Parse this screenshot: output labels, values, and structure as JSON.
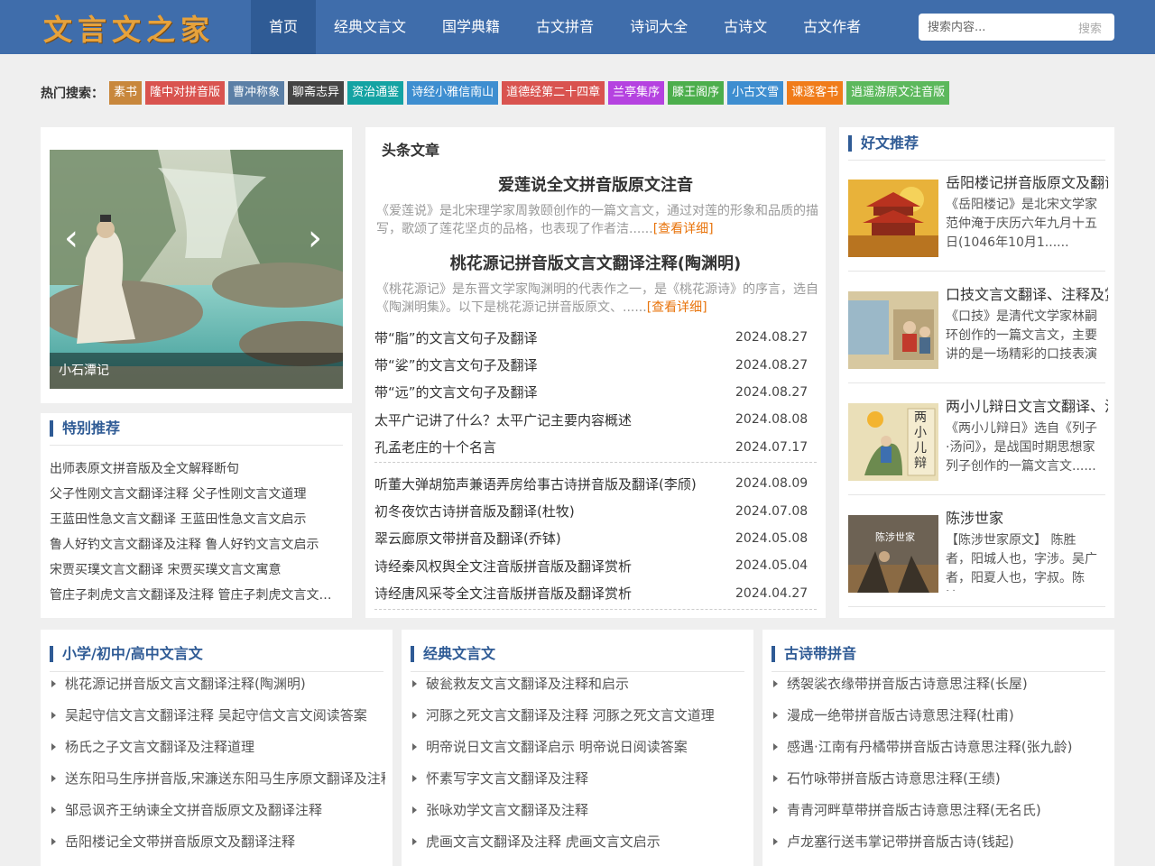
{
  "header": {
    "logo": "文言文之家",
    "nav": [
      "首页",
      "经典文言文",
      "国学典籍",
      "古文拼音",
      "诗词大全",
      "古诗文",
      "古文作者"
    ],
    "search_placeholder": "搜索内容...",
    "search_button": "搜索"
  },
  "hot": {
    "label": "热门搜索：",
    "tags": [
      {
        "text": "素书",
        "color": "#c8873c"
      },
      {
        "text": "隆中对拼音版",
        "color": "#d9534f"
      },
      {
        "text": "曹冲称象",
        "color": "#5b7fa6"
      },
      {
        "text": "聊斋志异",
        "color": "#444444"
      },
      {
        "text": "资治通鉴",
        "color": "#14a3a3"
      },
      {
        "text": "诗经小雅信南山",
        "color": "#3e8ed0"
      },
      {
        "text": "道德经第二十四章",
        "color": "#d9534f"
      },
      {
        "text": "兰亭集序",
        "color": "#b542e0"
      },
      {
        "text": "滕王阁序",
        "color": "#4cae4c"
      },
      {
        "text": "小古文雪",
        "color": "#3e8ed0"
      },
      {
        "text": "谏逐客书",
        "color": "#f07c1a"
      },
      {
        "text": "逍遥游原文注音版",
        "color": "#5cb85c"
      }
    ]
  },
  "slider": {
    "caption": "小石潭记"
  },
  "special": {
    "title": "特别推荐",
    "items": [
      "出师表原文拼音版及全文解释断句",
      "父子性刚文言文翻译注释 父子性刚文言文道理",
      "王蓝田性急文言文翻译 王蓝田性急文言文启示",
      "鲁人好钓文言文翻译及注释 鲁人好钓文言文启示",
      "宋贾买璞文言文翻译 宋贾买璞文言文寓意",
      "管庄子刺虎文言文翻译及注释 管庄子刺虎文言文启示"
    ]
  },
  "headline": {
    "heading": "头条文章",
    "featured": [
      {
        "title": "爱莲说全文拼音版原文注音",
        "desc": "《爱莲说》是北宋理学家周敦颐创作的一篇文言文，通过对莲的形象和品质的描写，歌颂了莲花坚贞的品格，也表现了作者洁......",
        "more": "[查看详细]"
      },
      {
        "title": "桃花源记拼音版文言文翻译注释(陶渊明)",
        "desc": "《桃花源记》是东晋文学家陶渊明的代表作之一，是《桃花源诗》的序言，选自《陶渊明集》。以下是桃花源记拼音版原文、......",
        "more": "[查看详细]"
      }
    ],
    "list1": [
      {
        "title": "带“脂”的文言文句子及翻译",
        "date": "2024.08.27"
      },
      {
        "title": "带“娑”的文言文句子及翻译",
        "date": "2024.08.27"
      },
      {
        "title": "带“远”的文言文句子及翻译",
        "date": "2024.08.27"
      },
      {
        "title": "太平广记讲了什么？太平广记主要内容概述",
        "date": "2024.08.08"
      },
      {
        "title": "孔孟老庄的十个名言",
        "date": "2024.07.17"
      }
    ],
    "list2": [
      {
        "title": "听董大弹胡笳声兼语弄房给事古诗拼音版及翻译(李颀)",
        "date": "2024.08.09"
      },
      {
        "title": "初冬夜饮古诗拼音版及翻译(杜牧)",
        "date": "2024.07.08"
      },
      {
        "title": "翠云廊原文带拼音及翻译(乔钵)",
        "date": "2024.05.08"
      },
      {
        "title": "诗经秦风权舆全文注音版拼音版及翻译赏析",
        "date": "2024.05.04"
      },
      {
        "title": "诗经唐风采苓全文注音版拼音版及翻译赏析",
        "date": "2024.04.27"
      }
    ]
  },
  "recommend": {
    "title": "好文推荐",
    "items": [
      {
        "title": "岳阳楼记拼音版原文及翻译",
        "desc": "《岳阳楼记》是北宋文学家范仲淹于庆历六年九月十五日(1046年10月1......"
      },
      {
        "title": "口技文言文翻译、注释及赏析",
        "desc": "《口技》是清代文学家林嗣环创作的一篇文言文，主要讲的是一场精彩的口技表演"
      },
      {
        "title": "两小儿辩日文言文翻译、注释",
        "desc": "《两小儿辩日》选自《列子·汤问》，是战国时期思想家列子创作的一篇文言文......"
      },
      {
        "title": "陈涉世家",
        "desc": "【陈涉世家原文】 陈胜者，阳城人也，字涉。吴广者，阳夏人也，字叔。陈涉......"
      }
    ],
    "thumb_labels": [
      "两小儿辩",
      "陈涉世家"
    ]
  },
  "bottom": [
    {
      "title": "小学/初中/高中文言文",
      "items": [
        "桃花源记拼音版文言文翻译注释(陶渊明)",
        "吴起守信文言文翻译注释 吴起守信文言文阅读答案",
        "杨氏之子文言文翻译及注释道理",
        "送东阳马生序拼音版,宋濂送东阳马生序原文翻译及注释",
        "邹忌讽齐王纳谏全文拼音版原文及翻译注释",
        "岳阳楼记全文带拼音版原文及翻译注释"
      ]
    },
    {
      "title": "经典文言文",
      "items": [
        "破瓮救友文言文翻译及注释和启示",
        "河豚之死文言文翻译及注释 河豚之死文言文道理",
        "明帝说日文言文翻译启示 明帝说日阅读答案",
        "怀素写字文言文翻译及注释",
        "张咏劝学文言文翻译及注释",
        "虎画文言文翻译及注释 虎画文言文启示"
      ]
    },
    {
      "title": "古诗带拼音",
      "items": [
        "绣袈裟衣缘带拼音版古诗意思注释(长屋)",
        "漫成一绝带拼音版古诗意思注释(杜甫)",
        "感遇·江南有丹橘带拼音版古诗意思注释(张九龄)",
        "石竹咏带拼音版古诗意思注释(王绩)",
        "青青河畔草带拼音版古诗意思注释(无名氏)",
        "卢龙塞行送韦掌记带拼音版古诗(钱起)"
      ]
    }
  ]
}
